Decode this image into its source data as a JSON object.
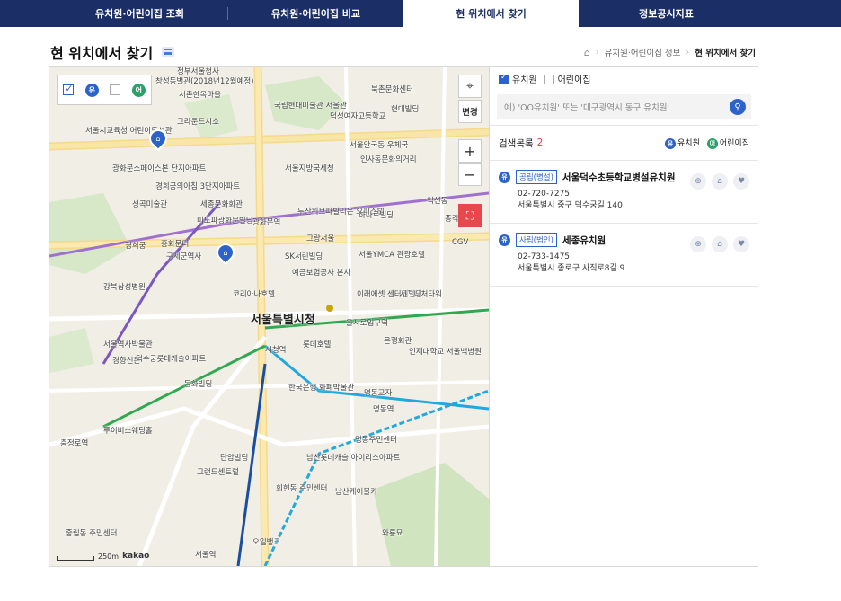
{
  "nav": {
    "tabs": [
      {
        "label": "유치원·어린이집 조회"
      },
      {
        "label": "유치원·어린이집 비교"
      },
      {
        "label": "현 위치에서 찾기"
      },
      {
        "label": "정보공시지표"
      }
    ],
    "active_index": 2
  },
  "page": {
    "title": "현 위치에서 찾기"
  },
  "breadcrumb": {
    "home_icon": "home-icon",
    "items": [
      "유치원·어린이집 정보",
      "현 위치에서 찾기"
    ]
  },
  "map": {
    "filter": {
      "kindergarten_badge": "유",
      "daycare_badge": "어"
    },
    "change_label": "변경",
    "zoom_in": "+",
    "zoom_out": "−",
    "scale_label": "250m",
    "brand": "kakao",
    "labels": {
      "l1": "정부서울청사",
      "l2": "창성동별관(2018년12월예정)",
      "l3": "서촌한옥마을",
      "l4": "국립현대미술관 서울관",
      "l5": "북촌문화센터",
      "l6": "현대빌딩",
      "l7": "덕성여자고등학교",
      "l8": "그라운드시소",
      "l9": "서울시교육청 어린이도서관",
      "l10": "광화문스페이스본 단지아파트",
      "l11": "경희궁의아침 3단지아파트",
      "l12": "성곡미술관",
      "l13": "세종문화회관",
      "l14": "미도파광화문빌딩",
      "l15": "서울지방국세청",
      "l16": "두산위브파빌리온 오피스텔",
      "l17": "하나로빌딩",
      "l18": "인사동문화의거리",
      "l19": "익선동",
      "l20": "서울안국동 우체국",
      "l21": "그랑서울",
      "l22": "SK서린빌딩",
      "l23": "서울YMCA 관광호텔",
      "l24": "예금보험공사 본사",
      "l25": "구세군역사",
      "l26": "강북삼성병원",
      "l27": "코리아나호텔",
      "l28": "이래에셋 센터원빌딩",
      "l29": "시그니처타워",
      "l30": "서울특별시청",
      "l31": "을지로입구역",
      "l32": "시청역",
      "l33": "롯데호텔",
      "l34": "은행회관",
      "l35": "인제대학교 서울백병원",
      "l36": "서울역사박물관",
      "l37": "경향신문",
      "l38": "덕수궁롯데캐슬아파트",
      "l39": "동화빌딩",
      "l40": "한국은행 화폐박물관",
      "l41": "명동교자",
      "l42": "명동주민센터",
      "l43": "충정로역",
      "l44": "루이비스웨딩홀",
      "l45": "단암빌딩",
      "l46": "남산롯데캐슬 아이리스아파트",
      "l47": "그랜드센트럴",
      "l48": "회현동 주민센터",
      "l49": "남산케이블카",
      "l50": "서울역",
      "l51": "오일뱅크",
      "l52": "와룡묘",
      "l53": "중림동 주민센터",
      "l54": "CGV",
      "l55": "광화문역",
      "l56": "종각역",
      "l57": "흥화문터",
      "l58": "경희궁",
      "l59": "명동역"
    }
  },
  "panel": {
    "type_filter": {
      "kindergarten": {
        "label": "유치원",
        "checked": true
      },
      "daycare": {
        "label": "어린이집",
        "checked": false
      }
    },
    "search": {
      "placeholder": "예) 'OO유치원' 또는 '대구광역시 동구 유치원'"
    },
    "list_header": {
      "label": "검색목록",
      "count": "2",
      "legend_kindergarten": "유치원",
      "legend_daycare": "어린이집",
      "legend_k_badge": "유",
      "legend_d_badge": "어"
    },
    "results": [
      {
        "badge": "유",
        "tag": "공립(병설)",
        "name": "서울덕수초등학교병설유치원",
        "phone": "02-720-7275",
        "address": "서울특별시 중구 덕수궁길 140"
      },
      {
        "badge": "유",
        "tag": "사립(법인)",
        "name": "세종유치원",
        "phone": "02-733-1475",
        "address": "서울특별시 종로구 사직로8길 9"
      }
    ]
  },
  "colors": {
    "nav_bg": "#1b2f66",
    "accent_blue": "#2d63c8",
    "accent_green": "#2aa06a",
    "count_red": "#e0433c",
    "fullscreen_red": "#e5484d"
  }
}
